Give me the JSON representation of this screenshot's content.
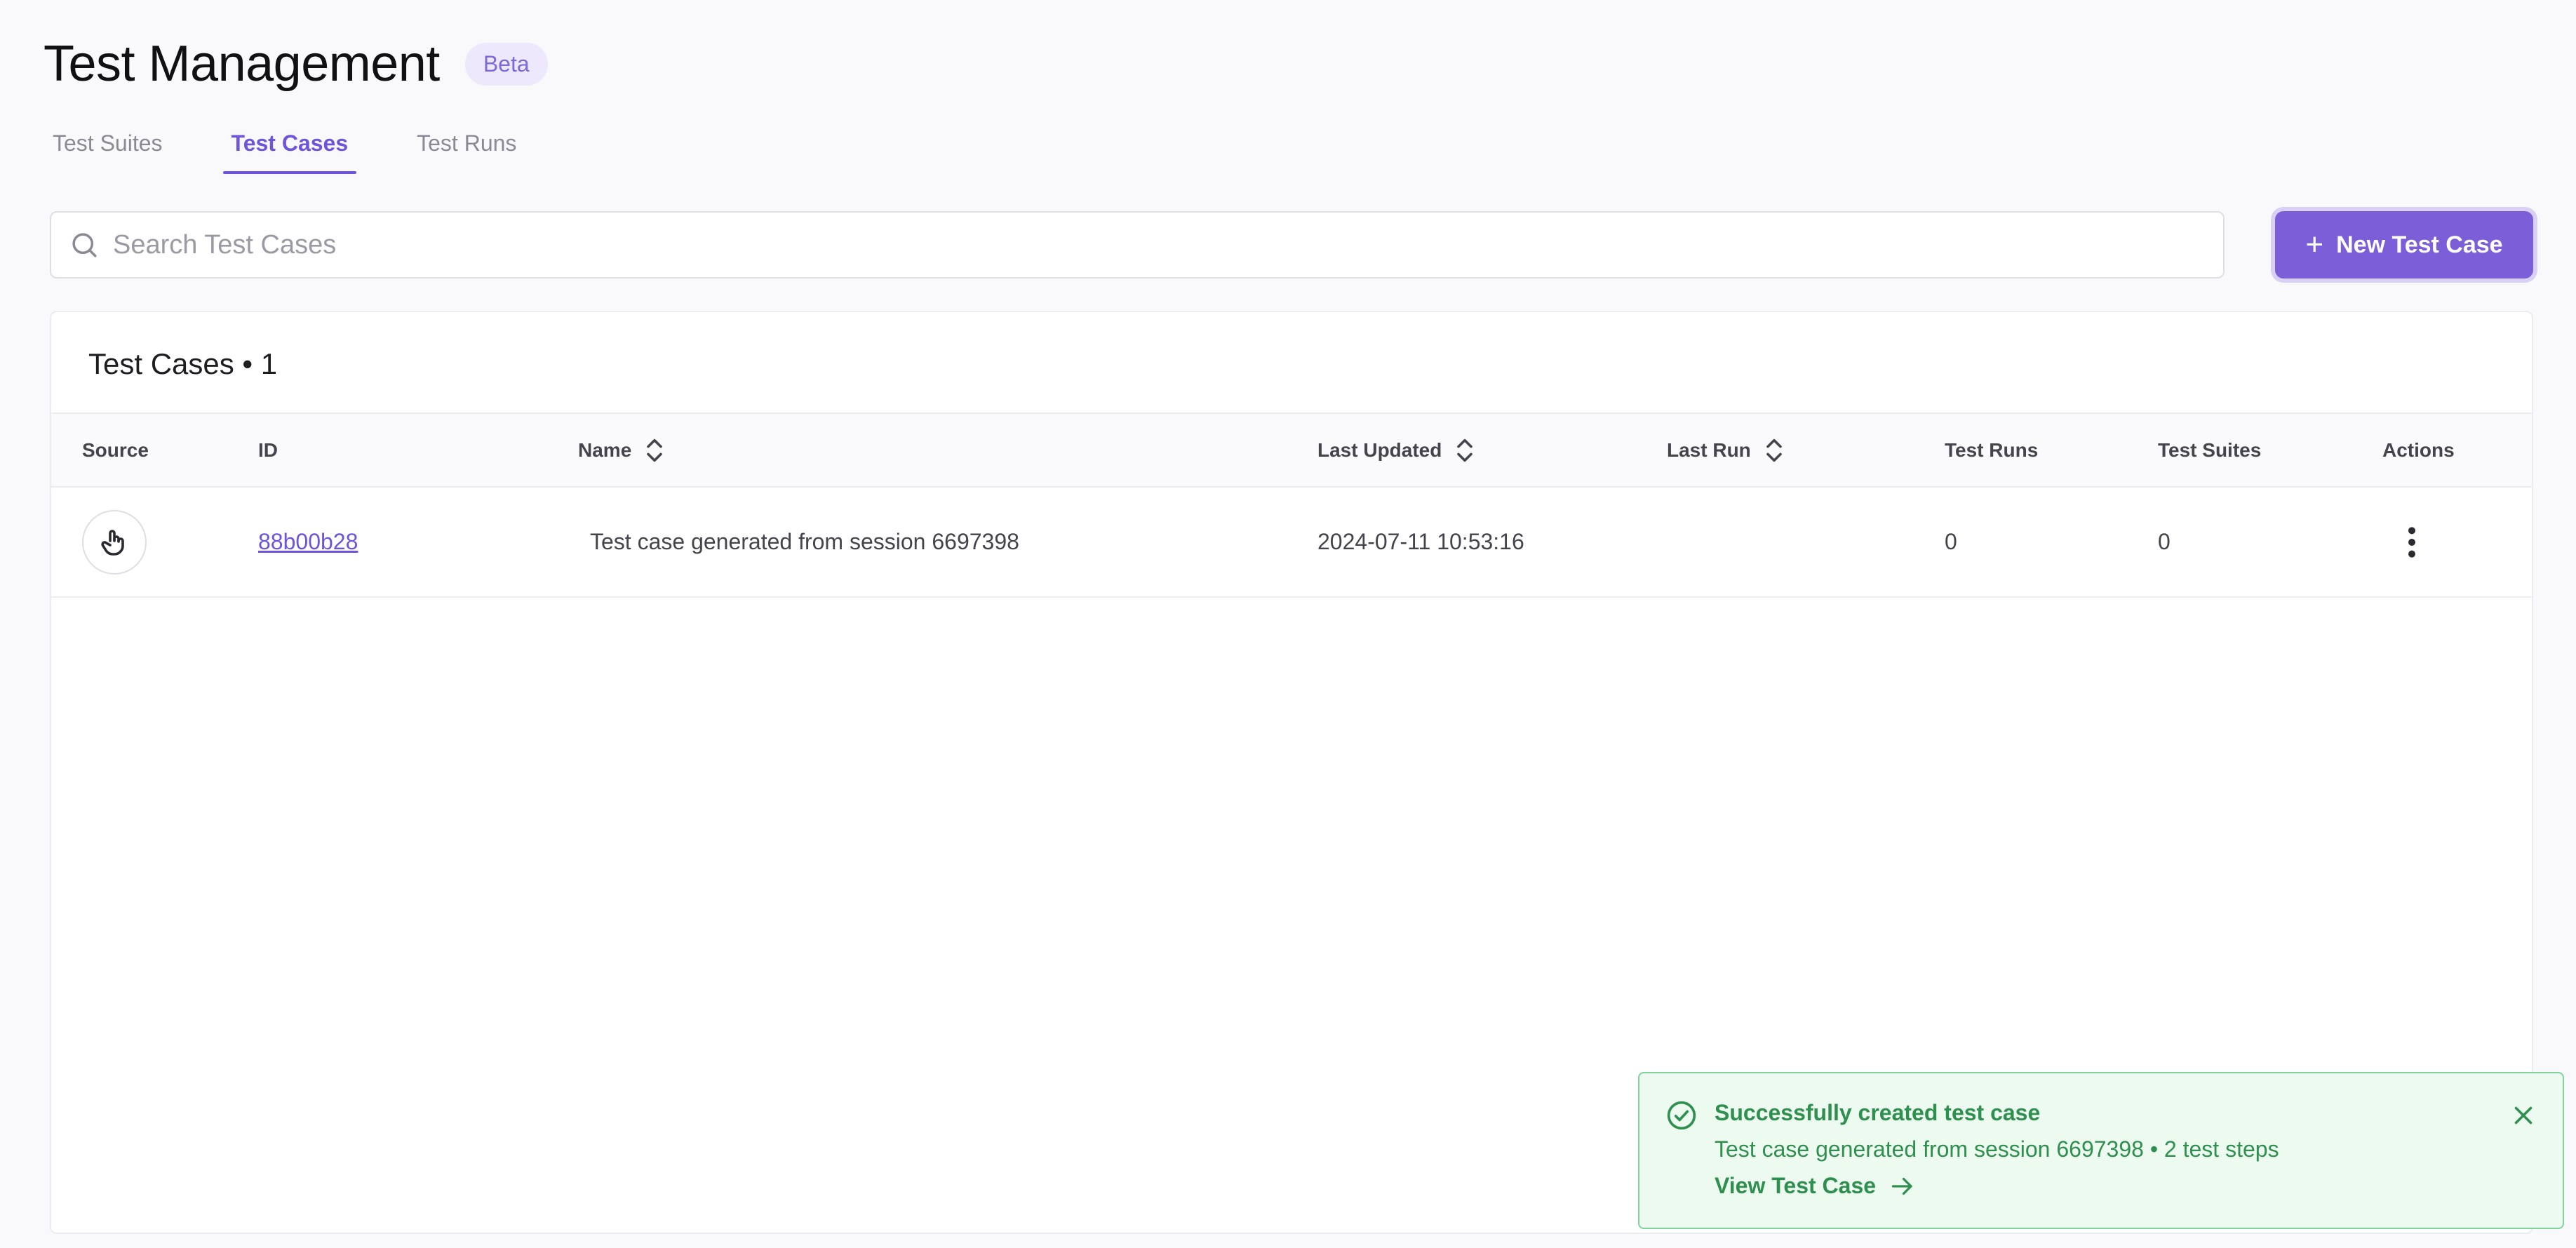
{
  "header": {
    "title": "Test Management",
    "badge": "Beta"
  },
  "tabs": [
    {
      "label": "Test Suites",
      "active": false
    },
    {
      "label": "Test Cases",
      "active": true
    },
    {
      "label": "Test Runs",
      "active": false
    }
  ],
  "search": {
    "placeholder": "Search Test Cases",
    "value": ""
  },
  "new_button": {
    "label": "New Test Case"
  },
  "table": {
    "title": "Test Cases • 1",
    "columns": {
      "source": "Source",
      "id": "ID",
      "name": "Name",
      "last_updated": "Last Updated",
      "last_run": "Last Run",
      "test_runs": "Test Runs",
      "test_suites": "Test Suites",
      "actions": "Actions"
    },
    "rows": [
      {
        "source_icon": "pointer-hand-icon",
        "id": "88b00b28",
        "name": "Test case generated from session 6697398",
        "last_updated": "2024-07-11 10:53:16",
        "last_run": "",
        "test_runs": "0",
        "test_suites": "0"
      }
    ]
  },
  "toast": {
    "title": "Successfully created test case",
    "body": "Test case generated from session 6697398 • 2 test steps",
    "link": "View Test Case"
  },
  "colors": {
    "accent": "#6e54d8",
    "button": "#7c5fd8",
    "success": "#2f8f4e",
    "success_bg": "#ecfaf0"
  }
}
